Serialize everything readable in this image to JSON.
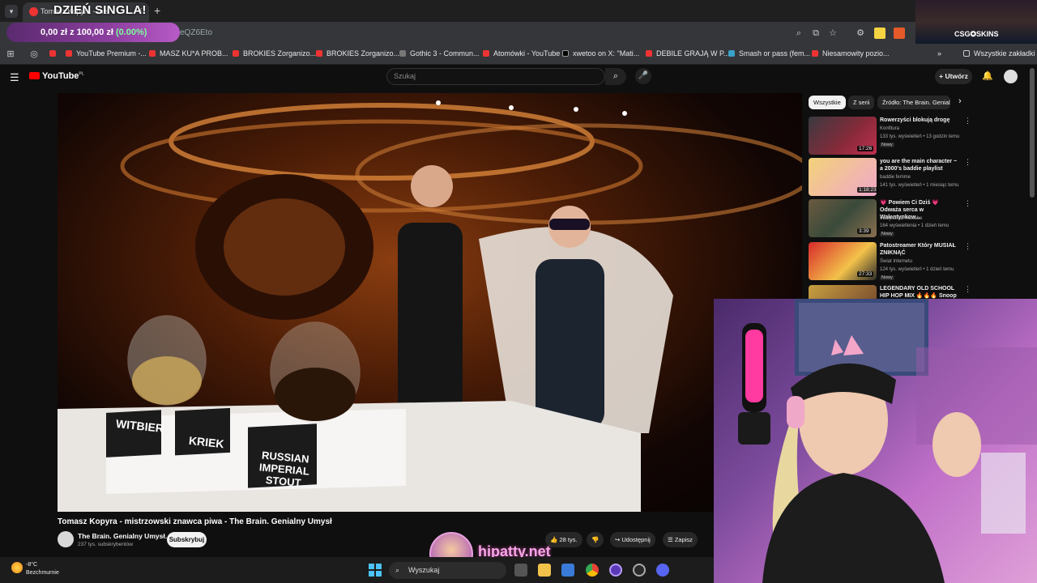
{
  "browser": {
    "tab_title": "Tomasz Kopyra - mis",
    "overlay_title": "DZIEŃ SINGLA!",
    "donation_text": "0,00 zł z 100,00 zł",
    "donation_pct": "(0.00%)",
    "url_fragment": "eQZ6Eto",
    "bookmarks": [
      "YouTube Premium -...",
      "MASZ KU*A PROB...",
      "BROKIES Zorganizo...",
      "BROKIES Zorganizo...",
      "Gothic 3 - Commun...",
      "Atomówki - YouTube",
      "xwetoo on X: \"Mati...",
      "DEBILE GRAJĄ W P...",
      "Smash or pass (fem...",
      "Niesamowity pozio..."
    ],
    "all_bookmarks": "Wszystkie zakładki",
    "sponsor_label": "CSG✪SKINS"
  },
  "youtube": {
    "logo": "YouTube",
    "logo_region": "PL",
    "search_placeholder": "Szukaj",
    "create_label": "Utwórz",
    "video_title": "Tomasz Kopyra - mistrzowski znawca piwa - The Brain. Genialny Umysł",
    "channel_name": "The Brain. Genialny Umysł.",
    "subscribers": "237 tys. subskrybentów",
    "subscribe_label": "Subskrybuj",
    "likes": "28 tys.",
    "share_label": "Udostępnij",
    "save_label": "Zapisz",
    "glass_labels": [
      "WITBIER",
      "KRIEK",
      "RUSSIAN IMPERIAL STOUT"
    ],
    "chips": [
      "Wszystkie",
      "Z serii",
      "Źródło: The Brain. Genialny"
    ],
    "recommendations": [
      {
        "title": "Rowerzyści blokują drogę",
        "channel": "Konfitura",
        "meta": "133 tys. wyświetleń • 13 godzin temu",
        "badge": "Nowy",
        "duration": "17:26"
      },
      {
        "title": "you are the main character ~ a 2000's baddie playlist",
        "channel": "baddie femme",
        "meta": "141 tys. wyświetleń • 1 miesiąc temu",
        "badge": "",
        "duration": "1:18:23"
      },
      {
        "title": "💗 Powiem Ci Dziś 💗 Odważa serca w Walentynkow...",
        "channel": "Muzyka na Youtube",
        "meta": "164 wyświetlenia • 1 dzień temu",
        "badge": "Nowy",
        "duration": "3:39"
      },
      {
        "title": "Patostreamer Który MUSIAŁ ZNIKNĄĆ",
        "channel": "Świat Internetu",
        "meta": "124 tys. wyświetleń • 1 dzień temu",
        "badge": "Nowy",
        "duration": "27:33"
      },
      {
        "title": "LEGENDARY OLD SCHOOL HIP HOP MIX 🔥🔥🔥 Snoop Dog",
        "channel": "",
        "meta": "",
        "badge": "",
        "duration": ""
      }
    ]
  },
  "taskbar": {
    "temperature": "-8°C",
    "weather": "Bezchmurnie",
    "search_label": "Wyszukaj"
  },
  "watermark": {
    "text": "hipatty.net"
  }
}
